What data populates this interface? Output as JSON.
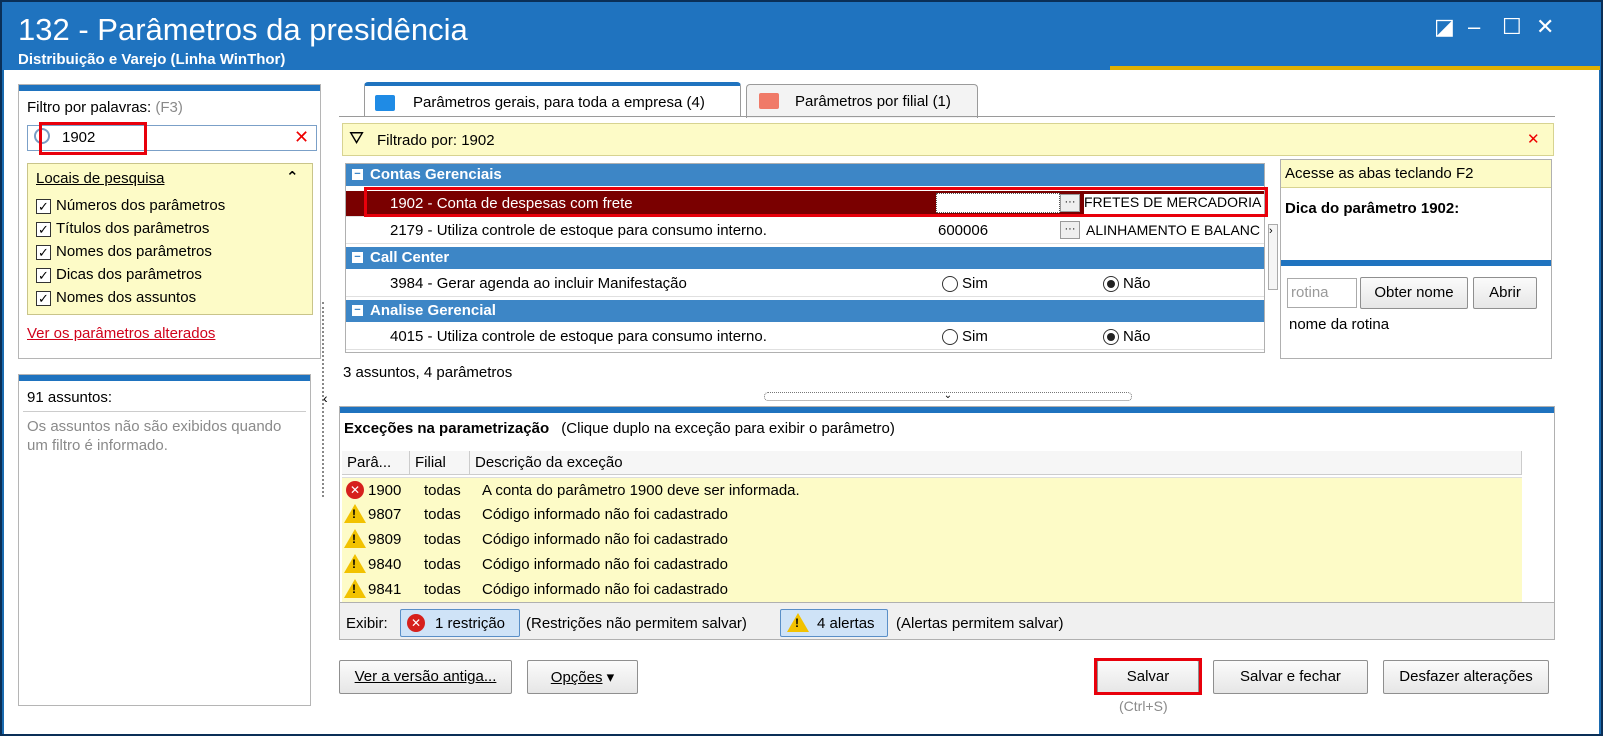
{
  "window": {
    "title": "132 - Parâmetros da presidência",
    "subtitle": "Distribuição e Varejo (Linha WinThor)"
  },
  "left": {
    "filter_label": "Filtro por palavras:",
    "filter_shortcut": "(F3)",
    "filter_value": "1902",
    "locais_label": "Locais de pesquisa",
    "checks": [
      "Números dos parâmetros",
      "Títulos dos parâmetros",
      "Nomes dos parâmetros",
      "Dicas dos parâmetros",
      "Nomes dos assuntos"
    ],
    "changed_link": "Ver os parâmetros alterados",
    "subjects_count": "91 assuntos:",
    "subjects_note": "Os assuntos não são exibidos quando um filtro é informado."
  },
  "tabs": [
    {
      "label": "Parâmetros gerais, para toda a empresa",
      "count": "(4)"
    },
    {
      "label": "Parâmetros por filial",
      "count": "(1)"
    }
  ],
  "filterbar": {
    "text": "Filtrado por: 1902"
  },
  "grid": {
    "groups": [
      {
        "title": "Contas Gerenciais",
        "rows": [
          {
            "text": "1902 - Conta de despesas com frete",
            "value": "",
            "desc": "FRETES DE MERCADORIA"
          },
          {
            "text": "2179 - Utiliza controle de estoque para consumo interno.",
            "value": "600006",
            "desc": "ALINHAMENTO E BALANC"
          }
        ]
      },
      {
        "title": "Call Center",
        "rows": [
          {
            "text": "3984 - Gerar agenda ao incluir Manifestação",
            "opt_yes": "Sim",
            "opt_no": "Não"
          }
        ]
      },
      {
        "title": "Analise Gerencial",
        "rows": [
          {
            "text": "4015 - Utiliza controle de estoque para consumo interno.",
            "opt_yes": "Sim",
            "opt_no": "Não"
          }
        ]
      }
    ],
    "summary": "3 assuntos, 4 parâmetros"
  },
  "tip": {
    "hint": "Acesse as abas teclando F2",
    "title": "Dica do parâmetro 1902:",
    "rotina_placeholder": "rotina",
    "btn_obter": "Obter nome",
    "btn_abrir": "Abrir",
    "rotina_label": "nome da rotina"
  },
  "exceptions": {
    "title": "Exceções na parametrização",
    "subtitle": "(Clique duplo na exceção para exibir o parâmetro)",
    "headers": [
      "Parâ...",
      "Filial",
      "Descrição da exceção"
    ],
    "rows": [
      {
        "type": "error",
        "param": "1900",
        "filial": "todas",
        "desc": "A conta do parâmetro 1900 deve ser informada."
      },
      {
        "type": "warning",
        "param": "9807",
        "filial": "todas",
        "desc": "Código informado não foi cadastrado"
      },
      {
        "type": "warning",
        "param": "9809",
        "filial": "todas",
        "desc": "Código informado não foi cadastrado"
      },
      {
        "type": "warning",
        "param": "9840",
        "filial": "todas",
        "desc": "Código informado não foi cadastrado"
      },
      {
        "type": "warning",
        "param": "9841",
        "filial": "todas",
        "desc": "Código informado não foi cadastrado"
      }
    ],
    "exibir_label": "Exibir:",
    "restr_btn": "1 restrição",
    "restr_note": "(Restrições não permitem salvar)",
    "alert_btn": "4 alertas",
    "alert_note": "(Alertas permitem salvar)"
  },
  "footer": {
    "old_version": "Ver a versão antiga...",
    "options": "Opções",
    "save": "Salvar",
    "save_shortcut": "(Ctrl+S)",
    "save_close": "Salvar e fechar",
    "undo": "Desfazer alterações"
  }
}
